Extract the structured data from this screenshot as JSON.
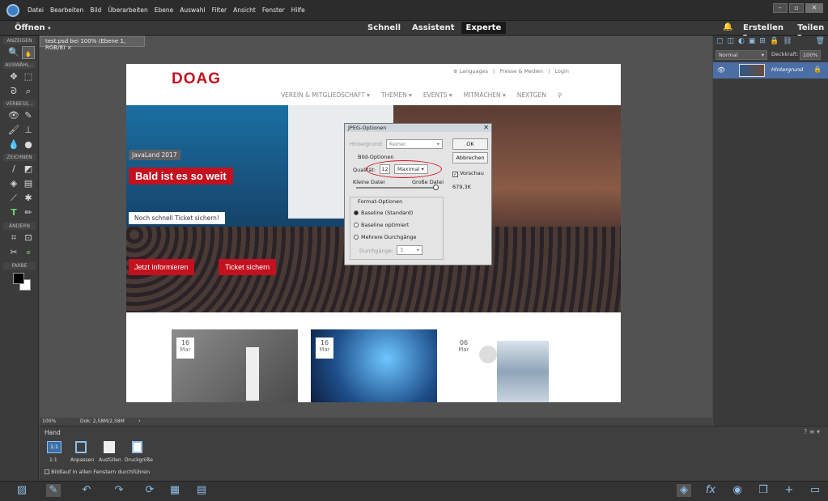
{
  "menubar": {
    "items": [
      "Datei",
      "Bearbeiten",
      "Bild",
      "Überarbeiten",
      "Ebene",
      "Auswahl",
      "Filter",
      "Ansicht",
      "Fenster",
      "Hilfe"
    ]
  },
  "topbar": {
    "open_label": "Öffnen",
    "modes": [
      "Schnell",
      "Assistent",
      "Experte"
    ],
    "active_mode": "Experte",
    "create_label": "Erstellen",
    "share_label": "Teilen"
  },
  "toolbox": {
    "sections": [
      "ANZEIGEN",
      "AUSWÄHL...",
      "VERBESS...",
      "ZEICHNEN",
      "ÄNDERN",
      "FARBE"
    ]
  },
  "document": {
    "tab_label": "test.psd bei 100% (Ebene 1, RGB/8)",
    "zoom": "100%",
    "doc_size": "Dok: 2,58M/2,58M"
  },
  "website": {
    "logo": "DOAG",
    "top_links": [
      "Languages",
      "|",
      "Presse & Medien",
      "|",
      "Login"
    ],
    "nav": [
      "VEREIN & MITGLIEDSCHAFT",
      "THEMEN",
      "EVENTS",
      "MITMACHEN",
      "NEXTGEN"
    ],
    "hero_badge": "JavaLand 2017",
    "hero_title": "Bald ist es so weit",
    "hero_sub": "Noch schnell Ticket sichern!",
    "btn_info": "Jetzt informieren",
    "btn_ticket": "Ticket sichern",
    "cards": [
      {
        "day": "16",
        "month": "Mar"
      },
      {
        "day": "16",
        "month": "Mar"
      },
      {
        "day": "06",
        "month": "Mar"
      }
    ]
  },
  "jpeg_dialog": {
    "title": "JPEG-Optionen",
    "matte_label": "Hintergrund:",
    "matte_value": "Keiner",
    "ok_label": "OK",
    "cancel_label": "Abbrechen",
    "image_options_label": "Bild-Optionen",
    "quality_label": "Qualität:",
    "quality_value": "12",
    "quality_preset": "Maximal",
    "preview_label": "Vorschau",
    "small_file": "Kleine Datei",
    "large_file": "Große Datei",
    "file_size": "679,3K",
    "format_options_label": "Format-Optionen",
    "format_options": [
      "Baseline (Standard)",
      "Baseline optimiert",
      "Mehrere Durchgänge"
    ],
    "selected_format": "Baseline (Standard)",
    "scans_label": "Durchgänge:",
    "scans_value": "3"
  },
  "layers": {
    "blend_mode": "Normal",
    "opacity_label": "Deckkraft:",
    "opacity_value": "100%",
    "layer_name": "Hintergrund"
  },
  "tool_options": {
    "tool_name": "Hand",
    "buttons": [
      "1:1",
      "Anpassen",
      "Ausfüllen",
      "Druckgröße"
    ],
    "scroll_all_label": "Bildlauf in allen Fenstern durchführen"
  },
  "colors": {
    "accent": "#c3111f",
    "ui_dark": "#3a3a3a"
  }
}
